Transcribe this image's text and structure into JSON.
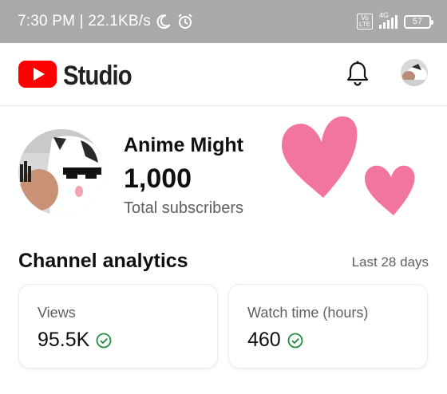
{
  "status_bar": {
    "text": "7:30 PM | 22.1KB/s",
    "network": "4G",
    "volte_label": "Vo LTE",
    "battery": "57",
    "icons": [
      "moon-icon",
      "alarm-icon",
      "signal-icon",
      "battery-icon"
    ]
  },
  "header": {
    "app_name": "Studio",
    "icons": [
      "youtube-logo-icon",
      "notification-bell-icon",
      "account-avatar"
    ],
    "accent": "#ff0000"
  },
  "channel": {
    "name": "Anime Might",
    "subscribers": "1,000",
    "subscribers_label": "Total subscribers"
  },
  "analytics": {
    "title": "Channel analytics",
    "range": "Last 28 days",
    "cards": [
      {
        "label": "Views",
        "value": "95.5K"
      },
      {
        "label": "Watch time (hours)",
        "value": "460"
      }
    ],
    "check_color": "#1e8e3e"
  },
  "decoration": {
    "heart_color": "#f06292"
  }
}
